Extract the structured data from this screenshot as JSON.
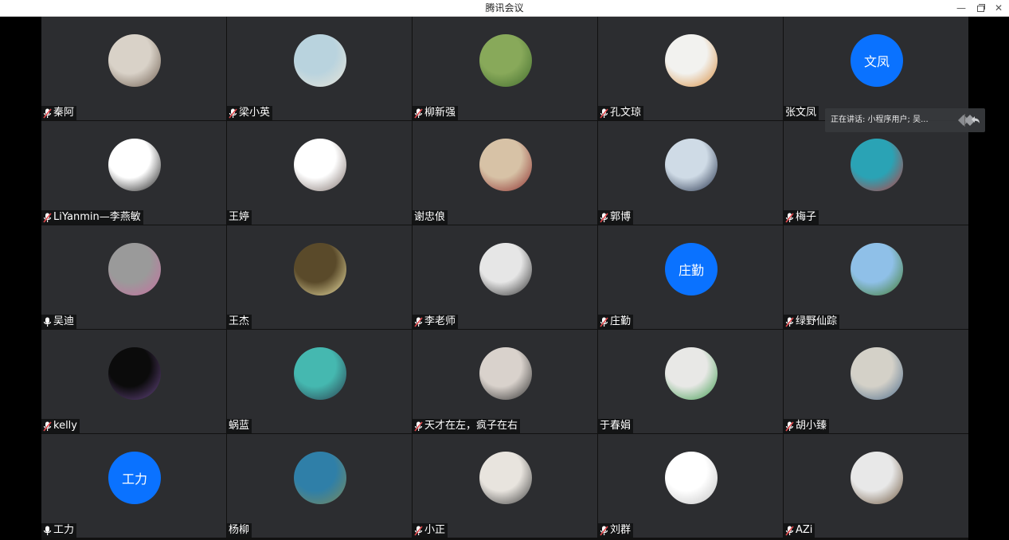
{
  "window": {
    "title": "腾讯会议",
    "minimize_glyph": "—",
    "close_glyph": "✕"
  },
  "speaking": {
    "text": "正在讲话: 小程序用户; 吴..."
  },
  "colors": {
    "initial_avatar_bg": "#0a72ff",
    "tile_bg": "#2c2d30",
    "mic_muted": "#e0474c"
  },
  "participants": [
    {
      "name": "秦阿",
      "mic": "muted",
      "avatar": "cat-photo"
    },
    {
      "name": "梁小英",
      "mic": "muted",
      "avatar": "beach-photo"
    },
    {
      "name": "柳新强",
      "mic": "muted",
      "avatar": "dandelion-photo"
    },
    {
      "name": "孔文琼",
      "mic": "muted",
      "avatar": "flower-photo"
    },
    {
      "name": "张文凤",
      "mic": "none",
      "avatar": "initials",
      "initials": "文凤"
    },
    {
      "name": "LiYanmin—李燕敏",
      "mic": "muted",
      "avatar": "swallow-drawing"
    },
    {
      "name": "王婷",
      "mic": "none",
      "avatar": "cartoon-girl"
    },
    {
      "name": "谢忠俍",
      "mic": "none",
      "avatar": "basketball-photo"
    },
    {
      "name": "郭博",
      "mic": "muted",
      "avatar": "boy-photo"
    },
    {
      "name": "梅子",
      "mic": "muted",
      "avatar": "underwater-photo"
    },
    {
      "name": "吴迪",
      "mic": "on",
      "avatar": "pink-flowers-photo"
    },
    {
      "name": "王杰",
      "mic": "none",
      "avatar": "flowers-vase-photo"
    },
    {
      "name": "李老师",
      "mic": "muted",
      "avatar": "sunglasses-portrait"
    },
    {
      "name": "庄勤",
      "mic": "muted",
      "avatar": "initials",
      "initials": "庄勤"
    },
    {
      "name": "绿野仙踪",
      "mic": "muted",
      "avatar": "mountain-photo"
    },
    {
      "name": "kelly",
      "mic": "muted",
      "avatar": "phone-screen-photo"
    },
    {
      "name": "蜗蓝",
      "mic": "none",
      "avatar": "anime-character"
    },
    {
      "name": "天才在左，疯子在右",
      "mic": "muted",
      "avatar": "mother-baby-photo"
    },
    {
      "name": "于春娟",
      "mic": "none",
      "avatar": "woman-green-shirt-photo"
    },
    {
      "name": "胡小臻",
      "mic": "muted",
      "avatar": "child-photo"
    },
    {
      "name": "工力",
      "mic": "on",
      "avatar": "initials",
      "initials": "工力"
    },
    {
      "name": "杨柳",
      "mic": "none",
      "avatar": "coast-photo"
    },
    {
      "name": "小正",
      "mic": "muted",
      "avatar": "toddler-photo"
    },
    {
      "name": "刘群",
      "mic": "muted",
      "avatar": "cartoon-dog"
    },
    {
      "name": "AZi",
      "mic": "muted",
      "avatar": "teddy-bear-photo"
    }
  ]
}
